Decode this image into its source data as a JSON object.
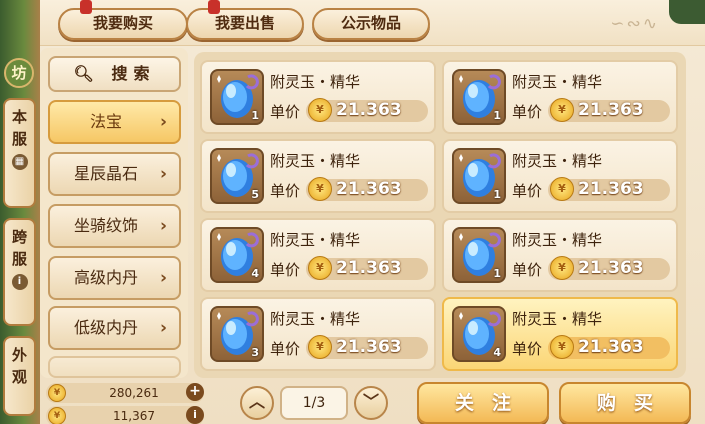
{
  "top_tabs": [
    {
      "label": "我要购买"
    },
    {
      "label": "我要出售"
    },
    {
      "label": "公示物品"
    }
  ],
  "corner_badge": "坊",
  "side_tabs": [
    {
      "label": "本服",
      "mini": "▦"
    },
    {
      "label": "跨服",
      "mini": "i"
    },
    {
      "label": "外观"
    }
  ],
  "search": {
    "label": "搜索",
    "icon": "search-icon"
  },
  "categories": [
    {
      "label": "法宝",
      "active": true
    },
    {
      "label": "星辰晶石"
    },
    {
      "label": "坐骑纹饰"
    },
    {
      "label": "高级内丹"
    },
    {
      "label": "低级内丹"
    }
  ],
  "items": [
    {
      "name": "附灵玉・精华",
      "price_label": "单价",
      "price": "21.363",
      "qty": "1"
    },
    {
      "name": "附灵玉・精华",
      "price_label": "单价",
      "price": "21.363",
      "qty": "1"
    },
    {
      "name": "附灵玉・精华",
      "price_label": "单价",
      "price": "21.363",
      "qty": "5"
    },
    {
      "name": "附灵玉・精华",
      "price_label": "单价",
      "price": "21.363",
      "qty": "1"
    },
    {
      "name": "附灵玉・精华",
      "price_label": "单价",
      "price": "21.363",
      "qty": "4"
    },
    {
      "name": "附灵玉・精华",
      "price_label": "单价",
      "price": "21.363",
      "qty": "1"
    },
    {
      "name": "附灵玉・精华",
      "price_label": "单价",
      "price": "21.363",
      "qty": "3"
    },
    {
      "name": "附灵玉・精华",
      "price_label": "单价",
      "price": "21.363",
      "qty": "4",
      "selected": true
    }
  ],
  "currency": [
    {
      "value": "280,261",
      "action": "+"
    },
    {
      "value": "11,367",
      "action": "i"
    }
  ],
  "pagination": {
    "current": "1/3",
    "prev_icon": "chevron-up-icon",
    "next_icon": "chevron-down-icon"
  },
  "actions": {
    "follow": "关注",
    "buy": "购买"
  },
  "colors": {
    "accent": "#f3b955",
    "selected_card": "#fbd676",
    "price_text": "#ffffff"
  }
}
